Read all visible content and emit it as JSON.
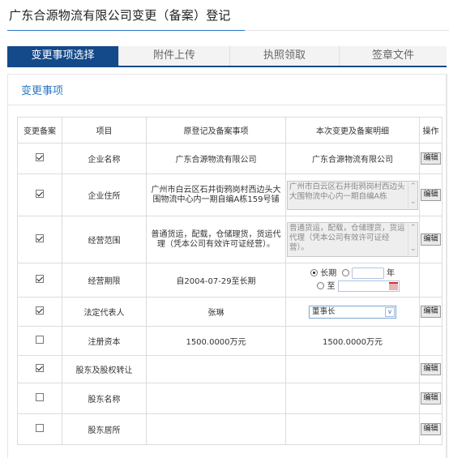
{
  "page": {
    "title": "广东合源物流有限公司变更（备案）登记"
  },
  "tabs": [
    {
      "label": "变更事项选择",
      "active": true
    },
    {
      "label": "附件上传"
    },
    {
      "label": "执照领取"
    },
    {
      "label": "签章文件"
    }
  ],
  "section": {
    "title": "变更事项"
  },
  "table": {
    "headers": [
      "变更备案",
      "项目",
      "原登记及备案事项",
      "本次变更及备案明细",
      "操作"
    ],
    "edit_label": "编辑",
    "rows": [
      {
        "checked": true,
        "item": "企业名称",
        "original": "广东合源物流有限公司",
        "change": "广东合源物流有限公司"
      },
      {
        "checked": true,
        "item": "企业住所",
        "original": "广州市白云区石井街鸦岗村西边头大围物流中心内一期自编A栋159号铺",
        "change": "广州市白云区石井街鸦岗村西边头大围物流中心内一期自编A栋"
      },
      {
        "checked": true,
        "item": "经营范围",
        "original": "普通货运，配载，仓储理货，货运代理（凭本公司有效许可证经营）。",
        "change": "普通货运，配载，仓储理货，货运代理（凭本公司有效许可证经营）。"
      },
      {
        "checked": true,
        "item": "经营期限",
        "original": "自2004-07-29至长期",
        "change": ""
      },
      {
        "checked": true,
        "item": "法定代表人",
        "original": "张琳",
        "change": "董事长"
      },
      {
        "checked": false,
        "item": "注册资本",
        "original": "1500.0000万元",
        "change": "1500.0000万元"
      },
      {
        "checked": true,
        "item": "股东及股权转让",
        "original": "",
        "change": ""
      },
      {
        "checked": false,
        "item": "股东名称",
        "original": "",
        "change": ""
      },
      {
        "checked": false,
        "item": "股东居所",
        "original": "",
        "change": ""
      }
    ],
    "period": {
      "long_label": "长期",
      "year_unit": "年",
      "to_label": "至"
    }
  }
}
